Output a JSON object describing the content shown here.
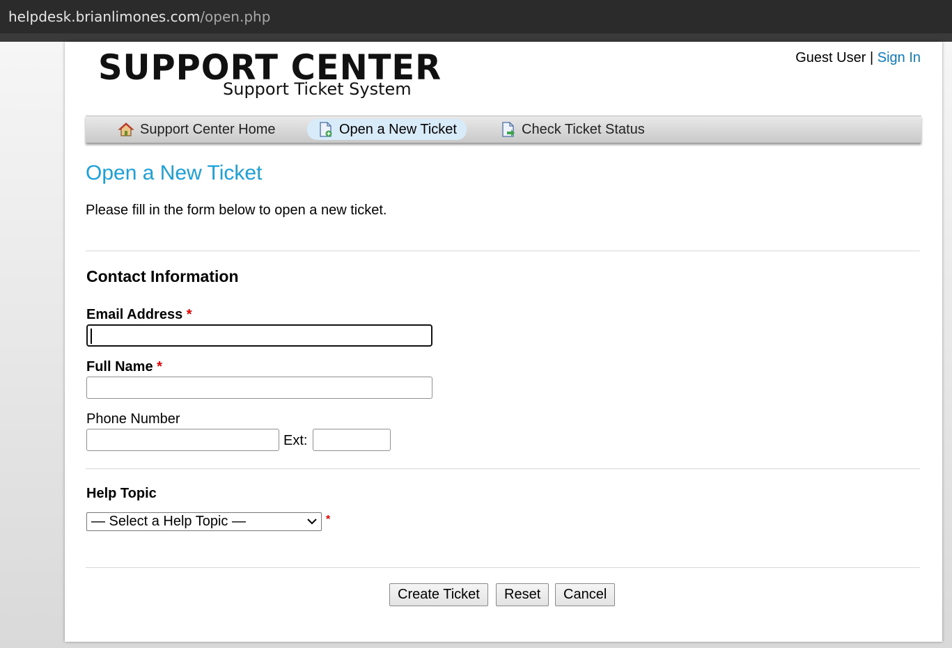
{
  "browser": {
    "url_host": "helpdesk.brianlimones.com",
    "url_path": "/open.php"
  },
  "header": {
    "logo_title": "SUPPORT CENTER",
    "logo_subtitle": "Support Ticket System",
    "guest_label": "Guest User",
    "separator": "|",
    "sign_in": "Sign In"
  },
  "nav": {
    "items": [
      {
        "label": "Support Center Home",
        "icon": "home-icon"
      },
      {
        "label": "Open a New Ticket",
        "icon": "new-ticket-icon",
        "active": true
      },
      {
        "label": "Check Ticket Status",
        "icon": "ticket-status-icon"
      }
    ]
  },
  "main": {
    "title": "Open a New Ticket",
    "intro": "Please fill in the form below to open a new ticket.",
    "contact_heading": "Contact Information",
    "email_label": "Email Address",
    "email_value": "",
    "fullname_label": "Full Name",
    "fullname_value": "",
    "phone_label": "Phone Number",
    "phone_value": "",
    "ext_label": "Ext:",
    "ext_value": "",
    "required_marker": "*",
    "help_topic_heading": "Help Topic",
    "help_topic_selected": "— Select a Help Topic —"
  },
  "buttons": {
    "create": "Create Ticket",
    "reset": "Reset",
    "cancel": "Cancel"
  },
  "colors": {
    "title": "#1aa0dc",
    "link": "#0a7ac2",
    "required": "#e00000",
    "active_tab": "#d8ebf8"
  }
}
